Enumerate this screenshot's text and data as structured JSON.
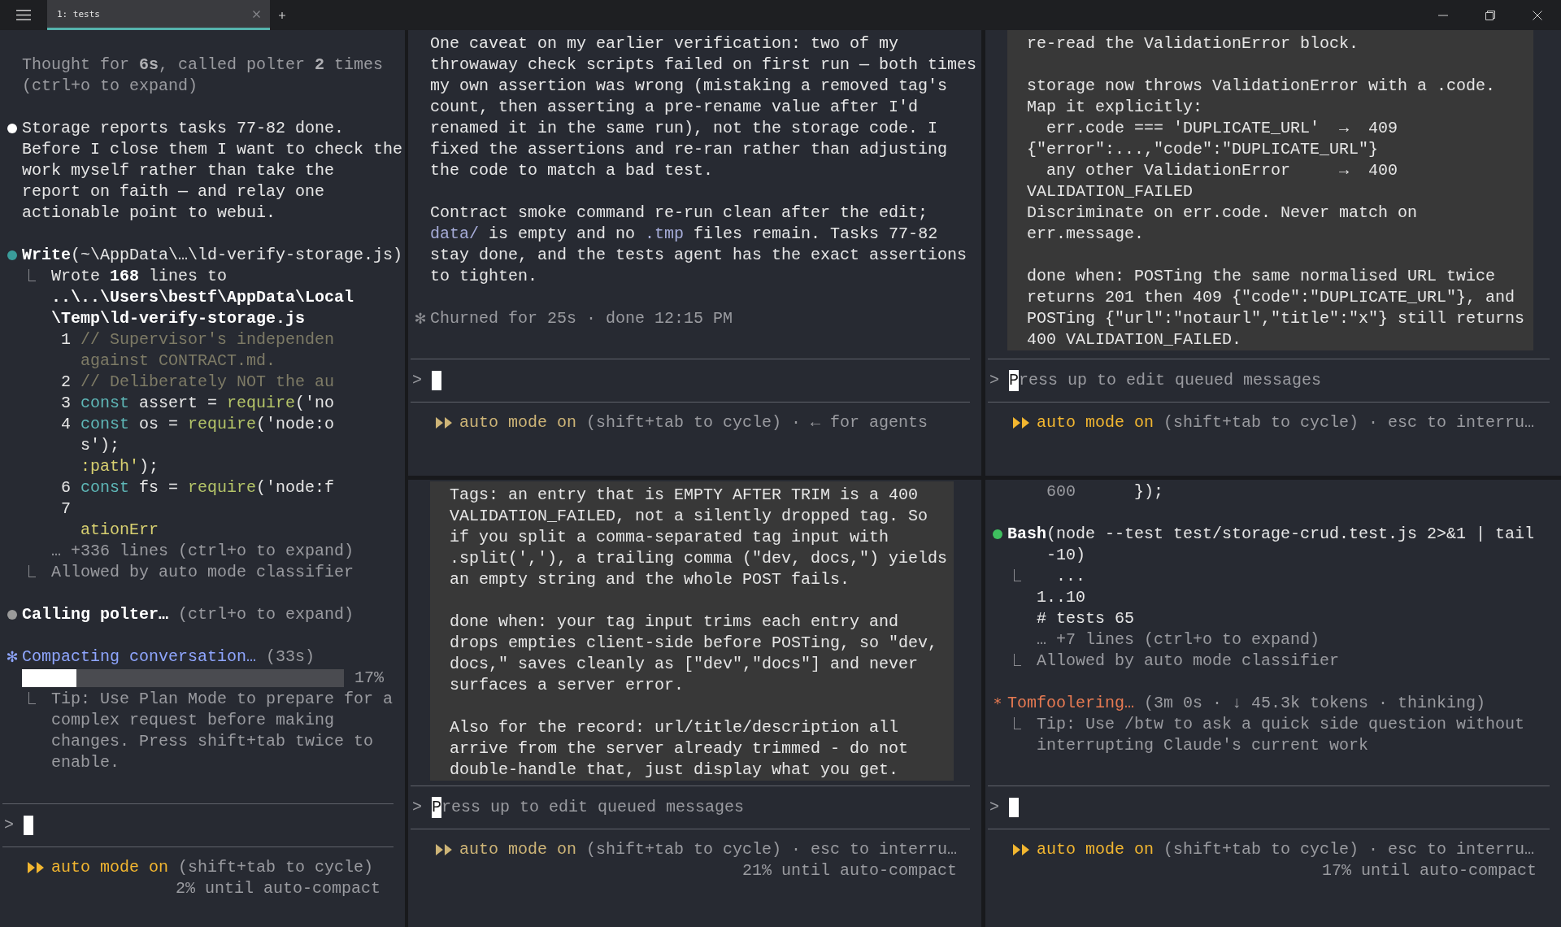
{
  "tabs": [
    {
      "label": "1: tests",
      "selected": true
    }
  ],
  "panes": [
    {
      "dimmed": false,
      "blocks": [
        {
          "kind": "plain",
          "lines": [
            {
              "kind": "text",
              "segments": [
                {
                  "text": "Thought for ",
                  "kind": "dim"
                },
                {
                  "text": "6s",
                  "kind": "dimbold"
                },
                {
                  "text": ", called polter ",
                  "kind": "dim"
                },
                {
                  "text": "2",
                  "kind": "dimbold"
                },
                {
                  "text": " times",
                  "kind": "dim"
                }
              ]
            },
            {
              "kind": "text",
              "segments": [
                {
                  "text": "(ctrl+o to expand)",
                  "kind": "dim"
                }
              ]
            },
            {
              "kind": "blank"
            },
            {
              "kind": "text",
              "marker": {
                "kind": "dot",
                "color": "#ffffff"
              },
              "segments": [
                {
                  "text": "Storage reports tasks 77-82 done.",
                  "kind": "plain"
                }
              ]
            },
            {
              "kind": "text",
              "segments": [
                {
                  "text": "Before I close them I want to check the",
                  "kind": "plain"
                }
              ]
            },
            {
              "kind": "text",
              "segments": [
                {
                  "text": "work myself rather than take the",
                  "kind": "plain"
                }
              ]
            },
            {
              "kind": "text",
              "segments": [
                {
                  "text": "report on faith — and relay one",
                  "kind": "plain"
                }
              ]
            },
            {
              "kind": "text",
              "segments": [
                {
                  "text": "actionable point to webui.",
                  "kind": "plain"
                }
              ]
            },
            {
              "kind": "blank"
            },
            {
              "kind": "text",
              "marker": {
                "kind": "dot",
                "color": "#3a9c9a"
              },
              "segments": [
                {
                  "text": "Write",
                  "kind": "bold"
                },
                {
                  "text": "(~\\AppData\\…\\ld-verify-storage.js)",
                  "kind": "plain"
                }
              ]
            },
            {
              "kind": "text",
              "branch": true,
              "segments": [
                {
                  "text": "Wrote ",
                  "kind": "plain"
                },
                {
                  "text": "168",
                  "kind": "bold"
                },
                {
                  "text": " lines to",
                  "kind": "plain"
                }
              ]
            },
            {
              "kind": "text",
              "segments": [
                {
                  "text": "   ..\\..\\Users\\bestf\\AppData\\Local",
                  "kind": "bold"
                }
              ]
            },
            {
              "kind": "text",
              "segments": [
                {
                  "text": "   \\Temp\\ld-verify-storage.js",
                  "kind": "bold"
                }
              ]
            },
            {
              "kind": "text",
              "segments": [
                {
                  "text": "    1 ",
                  "kind": "plain"
                },
                {
                  "text": "// Supervisor's independen",
                  "kind": "comment"
                }
              ]
            },
            {
              "kind": "text",
              "segments": [
                {
                  "text": "      against CONTRACT.md.",
                  "kind": "comment"
                }
              ]
            },
            {
              "kind": "text",
              "segments": [
                {
                  "text": "    2 ",
                  "kind": "plain"
                },
                {
                  "text": "// Deliberately NOT the au",
                  "kind": "comment"
                }
              ]
            },
            {
              "kind": "text",
              "segments": [
                {
                  "text": "    3 ",
                  "kind": "plain"
                },
                {
                  "text": "const",
                  "kind": "keyword"
                },
                {
                  "text": " assert = ",
                  "kind": "plain"
                },
                {
                  "text": "require",
                  "kind": "func"
                },
                {
                  "text": "('no",
                  "kind": "plain"
                }
              ]
            },
            {
              "kind": "text",
              "segments": [
                {
                  "text": "    4 ",
                  "kind": "plain"
                },
                {
                  "text": "const",
                  "kind": "keyword"
                },
                {
                  "text": " os = ",
                  "kind": "plain"
                },
                {
                  "text": "require",
                  "kind": "func"
                },
                {
                  "text": "('node:o",
                  "kind": "plain"
                }
              ]
            },
            {
              "kind": "text",
              "segments": [
                {
                  "text": "      s');",
                  "kind": "plain"
                }
              ]
            },
            {
              "kind": "text",
              "segments": [
                {
                  "text": "      :path'",
                  "kind": "ident"
                },
                {
                  "text": ");",
                  "kind": "plain"
                }
              ]
            },
            {
              "kind": "text",
              "segments": [
                {
                  "text": "    6 ",
                  "kind": "plain"
                },
                {
                  "text": "const",
                  "kind": "keyword"
                },
                {
                  "text": " fs = ",
                  "kind": "plain"
                },
                {
                  "text": "require",
                  "kind": "func"
                },
                {
                  "text": "('node:f",
                  "kind": "plain"
                }
              ]
            },
            {
              "kind": "text",
              "segments": [
                {
                  "text": "    7",
                  "kind": "plain"
                }
              ]
            },
            {
              "kind": "text",
              "segments": [
                {
                  "text": "      ationErr",
                  "kind": "ident"
                }
              ]
            },
            {
              "kind": "text",
              "segments": [
                {
                  "text": "   … +336 lines (ctrl+o to expand)",
                  "kind": "dim"
                }
              ]
            },
            {
              "kind": "text",
              "branch": true,
              "segments": [
                {
                  "text": "Allowed by auto mode classifier",
                  "kind": "dim"
                }
              ]
            },
            {
              "kind": "blank"
            },
            {
              "kind": "text",
              "marker": {
                "kind": "dot",
                "color": "#9a9a9a"
              },
              "segments": [
                {
                  "text": "Calling polter…",
                  "kind": "bold"
                },
                {
                  "text": " (ctrl+o to expand)",
                  "kind": "dim"
                }
              ]
            },
            {
              "kind": "blank"
            },
            {
              "kind": "text",
              "marker": {
                "kind": "glyph",
                "text": "✻",
                "color": "#8fa6ff"
              },
              "segments": [
                {
                  "text": "Compacting conversation…",
                  "kind": "blue"
                },
                {
                  "text": " (33s)",
                  "kind": "dim"
                }
              ]
            },
            {
              "kind": "progress",
              "level": 0.17,
              "reading": "17%"
            },
            {
              "kind": "text",
              "branch": true,
              "segments": [
                {
                  "text": "Tip: Use Plan Mode to prepare for a",
                  "kind": "dim"
                }
              ]
            },
            {
              "kind": "text",
              "segments": [
                {
                  "text": "   complex request before making",
                  "kind": "dim"
                }
              ]
            },
            {
              "kind": "text",
              "segments": [
                {
                  "text": "   changes. Press shift+tab twice to",
                  "kind": "dim"
                }
              ]
            },
            {
              "kind": "text",
              "segments": [
                {
                  "text": "   enable.",
                  "kind": "dim"
                }
              ]
            }
          ]
        }
      ],
      "prompt": {
        "symbol": ">"
      },
      "footer": {
        "mode": "auto mode on",
        "hint": "(shift+tab to cycle)",
        "status": "2% until auto-compact"
      }
    },
    {
      "dimmed": true,
      "blocks": [
        {
          "kind": "plain",
          "lines": [
            {
              "kind": "text",
              "segments": [
                {
                  "text": "One caveat on my earlier verification: two of my",
                  "kind": "plain"
                }
              ]
            },
            {
              "kind": "text",
              "segments": [
                {
                  "text": "throwaway check scripts failed on first run — both times",
                  "kind": "plain"
                }
              ]
            },
            {
              "kind": "text",
              "segments": [
                {
                  "text": "my own assertion was wrong (mistaking a removed tag's",
                  "kind": "plain"
                }
              ]
            },
            {
              "kind": "text",
              "segments": [
                {
                  "text": "count, then asserting a pre-rename value after I'd",
                  "kind": "plain"
                }
              ]
            },
            {
              "kind": "text",
              "segments": [
                {
                  "text": "renamed it in the same run), not the storage code. I",
                  "kind": "plain"
                }
              ]
            },
            {
              "kind": "text",
              "segments": [
                {
                  "text": "fixed the assertions and re-ran rather than adjusting",
                  "kind": "plain"
                }
              ]
            },
            {
              "kind": "text",
              "segments": [
                {
                  "text": "the code to match a bad test.",
                  "kind": "plain"
                }
              ]
            },
            {
              "kind": "blank"
            },
            {
              "kind": "text",
              "segments": [
                {
                  "text": "Contract smoke command re-run clean after the edit;",
                  "kind": "plain"
                }
              ]
            },
            {
              "kind": "text",
              "segments": [
                {
                  "text": "data/",
                  "kind": "path"
                },
                {
                  "text": " is empty and no ",
                  "kind": "plain"
                },
                {
                  "text": ".tmp",
                  "kind": "path"
                },
                {
                  "text": " files remain. Tasks 77-82",
                  "kind": "plain"
                }
              ]
            },
            {
              "kind": "text",
              "segments": [
                {
                  "text": "stay done, and the tests agent has the exact assertions",
                  "kind": "plain"
                }
              ]
            },
            {
              "kind": "text",
              "segments": [
                {
                  "text": "to tighten.",
                  "kind": "plain"
                }
              ]
            },
            {
              "kind": "blank"
            },
            {
              "kind": "text",
              "marker": {
                "kind": "glyph",
                "text": "✻",
                "color": "#8a8b90"
              },
              "segments": [
                {
                  "text": "Churned for 25s · done 12:15 PM",
                  "kind": "dim"
                }
              ]
            }
          ]
        }
      ],
      "prompt": {
        "symbol": ">"
      },
      "footer": {
        "mode": "auto mode on",
        "hint": "(shift+tab to cycle) · ← for agents"
      }
    },
    {
      "dimmed": false,
      "blocks": [
        {
          "kind": "quote",
          "lines": [
            {
              "kind": "text",
              "segments": [
                {
                  "text": "re-read the ValidationError block.",
                  "kind": "plain"
                }
              ]
            },
            {
              "kind": "blank"
            },
            {
              "kind": "text",
              "segments": [
                {
                  "text": "storage now throws ValidationError with a .code.",
                  "kind": "plain"
                }
              ]
            },
            {
              "kind": "text",
              "segments": [
                {
                  "text": "Map it explicitly:",
                  "kind": "plain"
                }
              ]
            },
            {
              "kind": "text",
              "segments": [
                {
                  "text": "  err.code === 'DUPLICATE_URL'  →  409",
                  "kind": "plain"
                }
              ]
            },
            {
              "kind": "text",
              "segments": [
                {
                  "text": "{\"error\":...,\"code\":\"DUPLICATE_URL\"}",
                  "kind": "plain"
                }
              ]
            },
            {
              "kind": "text",
              "segments": [
                {
                  "text": "  any other ValidationError     →  400",
                  "kind": "plain"
                }
              ]
            },
            {
              "kind": "text",
              "segments": [
                {
                  "text": "VALIDATION_FAILED",
                  "kind": "plain"
                }
              ]
            },
            {
              "kind": "text",
              "segments": [
                {
                  "text": "Discriminate on err.code. Never match on",
                  "kind": "plain"
                }
              ]
            },
            {
              "kind": "text",
              "segments": [
                {
                  "text": "err.message.",
                  "kind": "plain"
                }
              ]
            },
            {
              "kind": "blank"
            },
            {
              "kind": "text",
              "segments": [
                {
                  "text": "done when: POSTing the same normalised URL twice",
                  "kind": "plain"
                }
              ]
            },
            {
              "kind": "text",
              "segments": [
                {
                  "text": "returns 201 then 409 {\"code\":\"DUPLICATE_URL\"}, and",
                  "kind": "plain"
                }
              ]
            },
            {
              "kind": "text",
              "segments": [
                {
                  "text": "POSTing {\"url\":\"notaurl\",\"title\":\"x\"} still returns",
                  "kind": "plain"
                }
              ]
            },
            {
              "kind": "text",
              "segments": [
                {
                  "text": "400 VALIDATION_FAILED.",
                  "kind": "plain"
                }
              ]
            }
          ]
        }
      ],
      "prompt": {
        "symbol": ">",
        "placeholder": "Press up to edit queued messages"
      },
      "footer": {
        "mode": "auto mode on",
        "hint": "(shift+tab to cycle) · esc to interru…"
      }
    },
    {
      "dimmed": true,
      "blocks": [
        {
          "kind": "quote",
          "lines": [
            {
              "kind": "text",
              "segments": [
                {
                  "text": "Tags: an entry that is EMPTY AFTER TRIM is a 400",
                  "kind": "plain"
                }
              ]
            },
            {
              "kind": "text",
              "segments": [
                {
                  "text": "VALIDATION_FAILED, not a silently dropped tag. So",
                  "kind": "plain"
                }
              ]
            },
            {
              "kind": "text",
              "segments": [
                {
                  "text": "if you split a comma-separated tag input with",
                  "kind": "plain"
                }
              ]
            },
            {
              "kind": "text",
              "segments": [
                {
                  "text": ".split(','), a trailing comma (\"dev, docs,\") yields",
                  "kind": "plain"
                }
              ]
            },
            {
              "kind": "text",
              "segments": [
                {
                  "text": "an empty string and the whole POST fails.",
                  "kind": "plain"
                }
              ]
            },
            {
              "kind": "blank"
            },
            {
              "kind": "text",
              "segments": [
                {
                  "text": "done when: your tag input trims each entry and",
                  "kind": "plain"
                }
              ]
            },
            {
              "kind": "text",
              "segments": [
                {
                  "text": "drops empties client-side before POSTing, so \"dev,",
                  "kind": "plain"
                }
              ]
            },
            {
              "kind": "text",
              "segments": [
                {
                  "text": "docs,\" saves cleanly as [\"dev\",\"docs\"] and never",
                  "kind": "plain"
                }
              ]
            },
            {
              "kind": "text",
              "segments": [
                {
                  "text": "surfaces a server error.",
                  "kind": "plain"
                }
              ]
            },
            {
              "kind": "blank"
            },
            {
              "kind": "text",
              "segments": [
                {
                  "text": "Also for the record: url/title/description all",
                  "kind": "plain"
                }
              ]
            },
            {
              "kind": "text",
              "segments": [
                {
                  "text": "arrive from the server already trimmed - do not",
                  "kind": "plain"
                }
              ]
            },
            {
              "kind": "text",
              "segments": [
                {
                  "text": "double-handle that, just display what you get.",
                  "kind": "plain"
                }
              ]
            }
          ]
        }
      ],
      "prompt": {
        "symbol": ">",
        "placeholder": "Press up to edit queued messages"
      },
      "footer": {
        "mode": "auto mode on",
        "hint": "(shift+tab to cycle) · esc to interru…",
        "status": "21% until auto-compact"
      }
    },
    {
      "dimmed": false,
      "blocks": [
        {
          "kind": "plain",
          "lines": [
            {
              "kind": "text",
              "segments": [
                {
                  "text": "    600",
                  "kind": "dim"
                },
                {
                  "text": "      });",
                  "kind": "plain"
                }
              ]
            },
            {
              "kind": "blank"
            },
            {
              "kind": "text",
              "marker": {
                "kind": "dot",
                "color": "#3fbf5f"
              },
              "segments": [
                {
                  "text": "Bash",
                  "kind": "bold"
                },
                {
                  "text": "(node --test test/storage-crud.test.js 2>&1 | tail",
                  "kind": "plain"
                }
              ]
            },
            {
              "kind": "text",
              "segments": [
                {
                  "text": "    -10)",
                  "kind": "plain"
                }
              ]
            },
            {
              "kind": "text",
              "branch": true,
              "segments": [
                {
                  "text": "  ...",
                  "kind": "plain"
                }
              ]
            },
            {
              "kind": "text",
              "segments": [
                {
                  "text": "   1..10",
                  "kind": "plain"
                }
              ]
            },
            {
              "kind": "text",
              "segments": [
                {
                  "text": "   # tests 65",
                  "kind": "plain"
                }
              ]
            },
            {
              "kind": "text",
              "segments": [
                {
                  "text": "   … +7 lines (ctrl+o to expand)",
                  "kind": "dim"
                }
              ]
            },
            {
              "kind": "text",
              "branch": true,
              "segments": [
                {
                  "text": "Allowed by auto mode classifier",
                  "kind": "dim"
                }
              ]
            },
            {
              "kind": "blank"
            },
            {
              "kind": "text",
              "marker": {
                "kind": "glyph",
                "text": "*",
                "color": "#e77a52"
              },
              "segments": [
                {
                  "text": "Tomfoolering…",
                  "kind": "orange"
                },
                {
                  "text": " (3m 0s · ↓ 45.3k tokens · thinking)",
                  "kind": "dim"
                }
              ]
            },
            {
              "kind": "text",
              "branch": true,
              "segments": [
                {
                  "text": "Tip: Use /btw to ask a quick side question without",
                  "kind": "dim"
                }
              ]
            },
            {
              "kind": "text",
              "segments": [
                {
                  "text": "   interrupting Claude's current work",
                  "kind": "dim"
                }
              ]
            }
          ]
        }
      ],
      "prompt": {
        "symbol": ">"
      },
      "footer": {
        "mode": "auto mode on",
        "hint": "(shift+tab to cycle) · esc to interru…",
        "status": "17% until auto-compact"
      }
    }
  ]
}
